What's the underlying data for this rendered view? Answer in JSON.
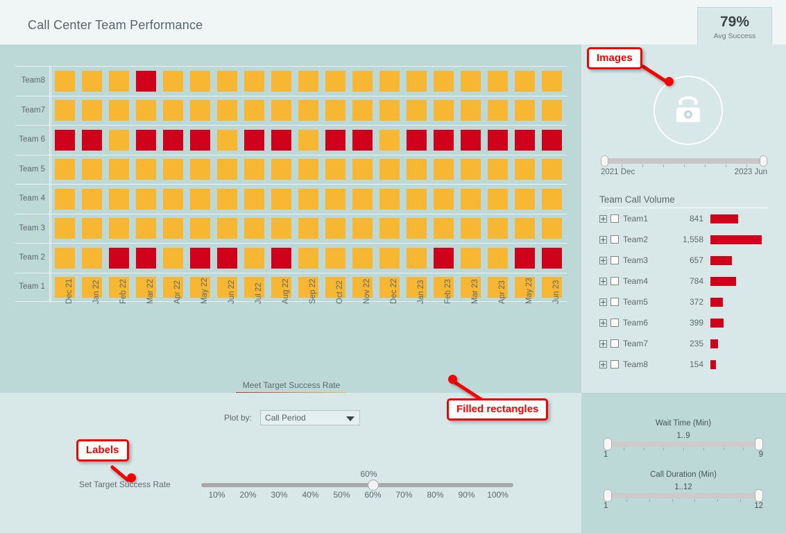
{
  "header": {
    "title": "Call Center Team Performance",
    "kpi": {
      "value": "79%",
      "label": "Avg Success"
    }
  },
  "colors": {
    "pass": "#f7b733",
    "fail": "#d0021b",
    "legend_low": "#c9283e",
    "legend_high": "#f2c14e",
    "panel_heatmap_bg": "#bdd9d7",
    "panel_light_bg": "#d8e8e8",
    "header_bg": "#eff6f5",
    "annotation": "#f60000"
  },
  "chart_data": {
    "type": "heatmap",
    "title": "Meet Target Success Rate",
    "xlabel": "",
    "ylabel": "",
    "legend": {
      "title": "Meet Target Success Rate",
      "min": "0",
      "max": "1"
    },
    "categories": [
      "Dec 21",
      "Jan 22",
      "Feb 22",
      "Mar 22",
      "Apr 22",
      "May 22",
      "Jun 22",
      "Jul 22",
      "Aug 22",
      "Sep 22",
      "Oct 22",
      "Nov 22",
      "Dec 22",
      "Jan 23",
      "Feb 23",
      "Mar 23",
      "Apr 23",
      "May 23",
      "Jun 23"
    ],
    "rows": [
      {
        "label": "Team8",
        "values": [
          1,
          1,
          1,
          0,
          1,
          1,
          1,
          1,
          1,
          1,
          1,
          1,
          1,
          1,
          1,
          1,
          1,
          1,
          1
        ]
      },
      {
        "label": "Team7",
        "values": [
          1,
          1,
          1,
          1,
          1,
          1,
          1,
          1,
          1,
          1,
          1,
          1,
          1,
          1,
          1,
          1,
          1,
          1,
          1
        ]
      },
      {
        "label": "Team 6",
        "values": [
          0,
          0,
          1,
          0,
          0,
          0,
          1,
          0,
          0,
          1,
          0,
          0,
          1,
          0,
          0,
          0,
          0,
          0,
          0
        ]
      },
      {
        "label": "Team 5",
        "values": [
          1,
          1,
          1,
          1,
          1,
          1,
          1,
          1,
          1,
          1,
          1,
          1,
          1,
          1,
          1,
          1,
          1,
          1,
          1
        ]
      },
      {
        "label": "Team 4",
        "values": [
          1,
          1,
          1,
          1,
          1,
          1,
          1,
          1,
          1,
          1,
          1,
          1,
          1,
          1,
          1,
          1,
          1,
          1,
          1
        ]
      },
      {
        "label": "Team 3",
        "values": [
          1,
          1,
          1,
          1,
          1,
          1,
          1,
          1,
          1,
          1,
          1,
          1,
          1,
          1,
          1,
          1,
          1,
          1,
          1
        ]
      },
      {
        "label": "Team 2",
        "values": [
          1,
          1,
          0,
          0,
          1,
          0,
          0,
          1,
          0,
          1,
          1,
          1,
          1,
          1,
          0,
          1,
          1,
          0,
          0
        ]
      },
      {
        "label": "Team 1",
        "values": [
          1,
          1,
          1,
          1,
          1,
          1,
          1,
          1,
          1,
          1,
          1,
          1,
          1,
          1,
          1,
          1,
          1,
          1,
          1
        ]
      }
    ]
  },
  "right_panel": {
    "image_icon": "telephone-icon",
    "date_slider": {
      "min_label": "2021 Dec",
      "max_label": "2023 Jun"
    },
    "team_call_volume": {
      "title": "Team Call Volume",
      "max_value": 1558,
      "rows": [
        {
          "name": "Team1",
          "value": "841",
          "num": 841
        },
        {
          "name": "Team2",
          "value": "1,558",
          "num": 1558
        },
        {
          "name": "Team3",
          "value": "657",
          "num": 657
        },
        {
          "name": "Team4",
          "value": "784",
          "num": 784
        },
        {
          "name": "Team5",
          "value": "372",
          "num": 372
        },
        {
          "name": "Team6",
          "value": "399",
          "num": 399
        },
        {
          "name": "Team7",
          "value": "235",
          "num": 235
        },
        {
          "name": "Team8",
          "value": "154",
          "num": 154
        }
      ]
    }
  },
  "bottom_left": {
    "plot_by_label": "Plot by:",
    "plot_by_value": "Call Period",
    "plot_by_options": [
      "Call Period"
    ],
    "target_label": "Set Target Success Rate",
    "target_value": "60%",
    "target_ticks": [
      "10%",
      "20%",
      "30%",
      "40%",
      "50%",
      "60%",
      "70%",
      "80%",
      "90%",
      "100%"
    ]
  },
  "bottom_right": {
    "wait_time": {
      "title": "Wait Time (Min)",
      "value": "1..9",
      "min_label": "1",
      "max_label": "9"
    },
    "call_duration": {
      "title": "Call Duration (Min)",
      "value": "1..12",
      "min_label": "1",
      "max_label": "12"
    }
  },
  "annotations": [
    {
      "id": "images",
      "label": "Images"
    },
    {
      "id": "filled_rectangles",
      "label": "Filled rectangles"
    },
    {
      "id": "labels",
      "label": "Labels"
    }
  ]
}
